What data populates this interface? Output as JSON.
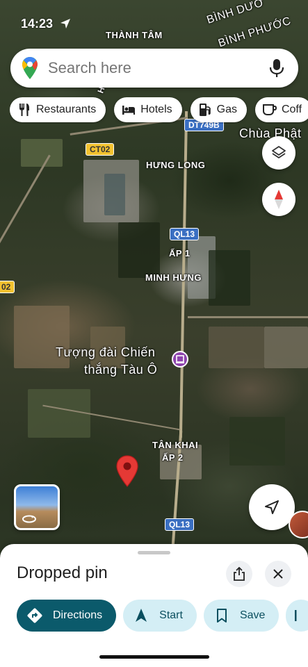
{
  "status_bar": {
    "time": "14:23"
  },
  "search": {
    "placeholder": "Search here"
  },
  "chips": [
    {
      "icon": "restaurant-icon",
      "label": "Restaurants"
    },
    {
      "icon": "hotel-icon",
      "label": "Hotels"
    },
    {
      "icon": "gas-station-icon",
      "label": "Gas"
    },
    {
      "icon": "coffee-icon",
      "label": "Coff"
    }
  ],
  "map": {
    "place_labels": {
      "thanh_tam": "THÀNH TÂM",
      "binh_duong": "BÌNH DƯƠ",
      "binh_phuoc": "BÌNH PHƯỚC",
      "chua_phat": "Chùa Phật",
      "hung_long": "HƯNG LONG",
      "ap_1": "ẤP 1",
      "minh_hung": "MINH HƯNG",
      "monument_line1": "Tượng đài Chiến",
      "monument_line2": "thắng Tàu Ô",
      "tan_khai": "TÂN KHAI",
      "ap_2": "ẤP 2",
      "hung_vert": "Hư"
    },
    "road_shields": {
      "dt749b": "DT749B",
      "ct02_top": "CT02",
      "ct02_left": "02",
      "ql13_mid": "QL13",
      "ql13_bottom": "QL13"
    },
    "colors": {
      "pin": "#e53935",
      "monument": "#8e44ad",
      "road_shield": "#3a6fc2",
      "ct_shield": "#f2c230"
    }
  },
  "bottom_sheet": {
    "title": "Dropped pin",
    "actions": [
      {
        "icon": "directions-icon",
        "label": "Directions",
        "style": "primary"
      },
      {
        "icon": "navigation-arrow-icon",
        "label": "Start",
        "style": "secondary"
      },
      {
        "icon": "bookmark-icon",
        "label": "Save",
        "style": "secondary"
      },
      {
        "icon": "more-icon",
        "label": "",
        "style": "secondary"
      }
    ]
  }
}
